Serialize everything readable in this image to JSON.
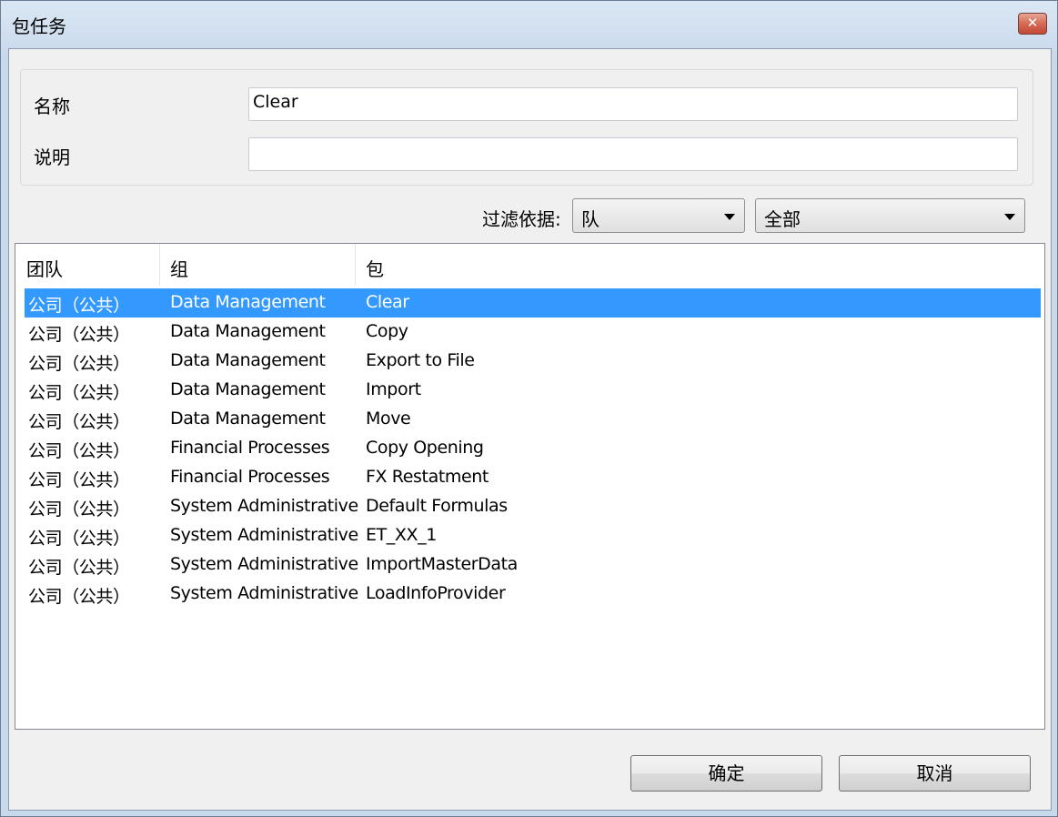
{
  "window": {
    "title": "包任务"
  },
  "form": {
    "name_label": "名称",
    "name_value": "Clear",
    "desc_label": "说明",
    "desc_value": ""
  },
  "filter": {
    "label": "过滤依据:",
    "type_value": "队",
    "scope_value": "全部"
  },
  "table": {
    "columns": [
      "团队",
      "组",
      "包"
    ],
    "rows": [
      [
        "公司（公共）",
        "Data Management",
        "Clear"
      ],
      [
        "公司（公共）",
        "Data Management",
        "Copy"
      ],
      [
        "公司（公共）",
        "Data Management",
        "Export to File"
      ],
      [
        "公司（公共）",
        "Data Management",
        "Import"
      ],
      [
        "公司（公共）",
        "Data Management",
        "Move"
      ],
      [
        "公司（公共）",
        "Financial Processes",
        "Copy Opening"
      ],
      [
        "公司（公共）",
        "Financial Processes",
        "FX Restatment"
      ],
      [
        "公司（公共）",
        "System Administrative",
        "Default Formulas"
      ],
      [
        "公司（公共）",
        "System Administrative",
        "ET_XX_1"
      ],
      [
        "公司（公共）",
        "System Administrative",
        "ImportMasterData"
      ],
      [
        "公司（公共）",
        "System Administrative",
        "LoadInfoProvider"
      ]
    ],
    "selected_index": 0
  },
  "buttons": {
    "ok": "确定",
    "cancel": "取消"
  },
  "colors": {
    "selection": "#3399ff",
    "close_button": "#c24a34"
  }
}
